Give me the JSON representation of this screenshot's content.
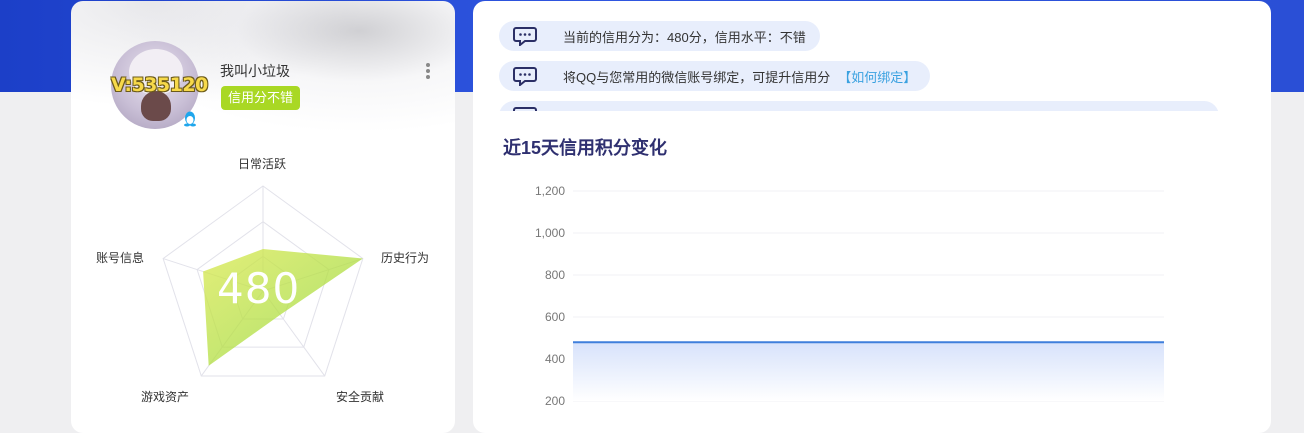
{
  "profile": {
    "username": "我叫小垃圾",
    "vip_text": "V:535120",
    "credit_tag": "信用分不错",
    "avatar_icon": "user-avatar",
    "more_icon": "more-vertical-icon"
  },
  "radar": {
    "score": "480",
    "axes": [
      {
        "label": "日常活跃",
        "value": 0.4
      },
      {
        "label": "历史行为",
        "value": 1.0
      },
      {
        "label": "安全贡献",
        "value": 0.28
      },
      {
        "label": "游戏资产",
        "value": 0.88
      },
      {
        "label": "账号信息",
        "value": 0.6
      }
    ]
  },
  "tips": [
    {
      "text": "当前的信用分为：480分，信用水平：不错",
      "link": ""
    },
    {
      "text": "将QQ与您常用的微信账号绑定，可提升信用分",
      "link": "【如何绑定】"
    },
    {
      "text": "",
      "link": ""
    }
  ],
  "chart_title": "近15天信用积分变化",
  "chart_data": {
    "type": "area",
    "title": "近15天信用积分变化",
    "xlabel": "",
    "ylabel": "",
    "ylim": [
      200,
      1200
    ],
    "yticks": [
      "1,200",
      "1,000",
      "800",
      "600",
      "400",
      "200"
    ],
    "series": [
      {
        "values": [
          480,
          480,
          480,
          480,
          480,
          480,
          480,
          480,
          480,
          480,
          480,
          480,
          480,
          480,
          480
        ]
      }
    ],
    "line_color": "#3f7fdc",
    "fill_color": "#dce6fb",
    "grid": true
  }
}
